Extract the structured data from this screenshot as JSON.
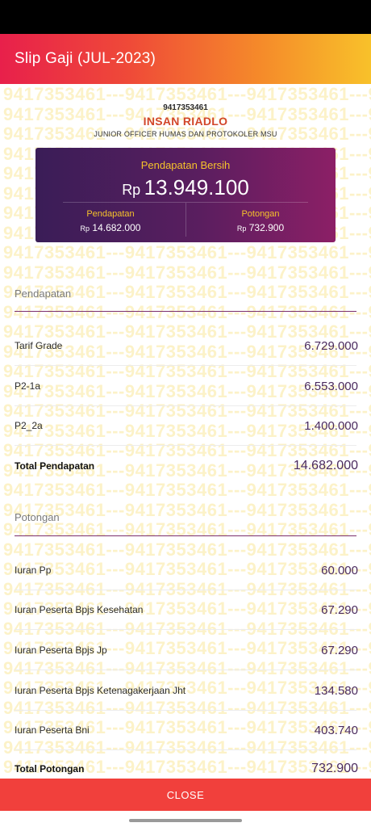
{
  "app_bar": {
    "title": "Slip Gaji (JUL-2023)"
  },
  "watermark": {
    "text": "9417353461---9417353461---9417353461---9417353461---9417353461"
  },
  "employee": {
    "id": "9417353461",
    "name": "INSAN RIADLO",
    "position": "JUNIOR OFFICER HUMAS DAN PROTOKOLER MSU"
  },
  "summary": {
    "net_label": "Pendapatan Bersih",
    "currency": "Rp",
    "net_value": "13.949.100",
    "income_label": "Pendapatan",
    "income_value": "14.682.000",
    "deduction_label": "Potongan",
    "deduction_value": "732.900"
  },
  "income": {
    "header": "Pendapatan",
    "items": [
      {
        "name": "Tarif Grade",
        "value": "6.729.000"
      },
      {
        "name": "P2-1a",
        "value": "6.553.000"
      },
      {
        "name": "P2_2a",
        "value": "1.400.000"
      }
    ],
    "total_label": "Total Pendapatan",
    "total_value": "14.682.000"
  },
  "deductions": {
    "header": "Potongan",
    "items": [
      {
        "name": "Iuran Pp",
        "value": "60.000"
      },
      {
        "name": "Iuran Peserta Bpjs Kesehatan",
        "value": "67.290"
      },
      {
        "name": "Iuran Peserta Bpjs Jp",
        "value": "67.290"
      },
      {
        "name": "Iuran Peserta Bpjs Ketenagakerjaan Jht",
        "value": "134.580"
      },
      {
        "name": "Iuran Peserta Bni",
        "value": "403.740"
      }
    ],
    "total_label": "Total Potongan",
    "total_value": "732.900"
  },
  "close_button": {
    "label": "CLOSE"
  },
  "colors": {
    "app_bar_gradient": [
      "#e8204b",
      "#f58a2a",
      "#f8c12a"
    ],
    "card_gradient": [
      "#3a1d57",
      "#8c1f66"
    ],
    "accent_yellow": "#f5c22b",
    "close_button": "#f1403c",
    "section_line": "#7c2f6c"
  }
}
